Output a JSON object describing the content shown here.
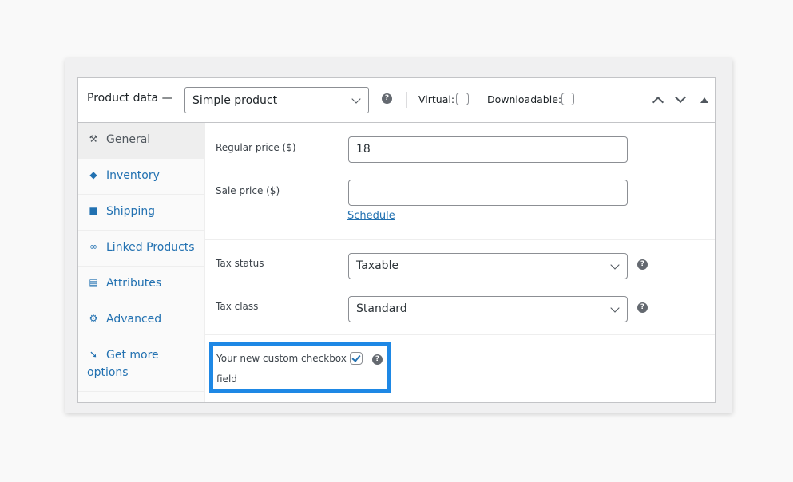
{
  "header": {
    "title": "Product data —",
    "product_type": "Simple product",
    "help_icon": "question-circle-icon",
    "virtual_label": "Virtual:",
    "virtual_checked": false,
    "downloadable_label": "Downloadable:",
    "downloadable_checked": false,
    "controls": [
      "move-up-icon",
      "move-down-icon",
      "toggle-collapse-icon"
    ]
  },
  "sidebar": {
    "items": [
      {
        "label": "General",
        "icon": "wrench-icon",
        "glyph": "🔧",
        "active": true
      },
      {
        "label": "Inventory",
        "icon": "tag-icon",
        "glyph": "◆",
        "active": false
      },
      {
        "label": "Shipping",
        "icon": "truck-icon",
        "glyph": "■",
        "active": false
      },
      {
        "label": "Linked Products",
        "icon": "link-icon",
        "glyph": "∞",
        "active": false
      },
      {
        "label": "Attributes",
        "icon": "list-card-icon",
        "glyph": "▤",
        "active": false
      },
      {
        "label": "Advanced",
        "icon": "gear-icon",
        "glyph": "⚙",
        "active": false
      },
      {
        "label": "Get more options",
        "icon": "plug-icon",
        "glyph": "➘",
        "active": false
      }
    ]
  },
  "pricing": {
    "regular_price_label": "Regular price ($)",
    "regular_price_value": "18",
    "sale_price_label": "Sale price ($)",
    "sale_price_value": "",
    "schedule_link": "Schedule"
  },
  "tax": {
    "status_label": "Tax status",
    "status_value": "Taxable",
    "class_label": "Tax class",
    "class_value": "Standard"
  },
  "custom": {
    "label_line1": "Your new custom checkbox",
    "label_line2": "field",
    "checked": true,
    "highlight_color": "#1e88e5"
  },
  "colors": {
    "link": "#2271b1",
    "active_tab_bg": "#eeeeee"
  }
}
